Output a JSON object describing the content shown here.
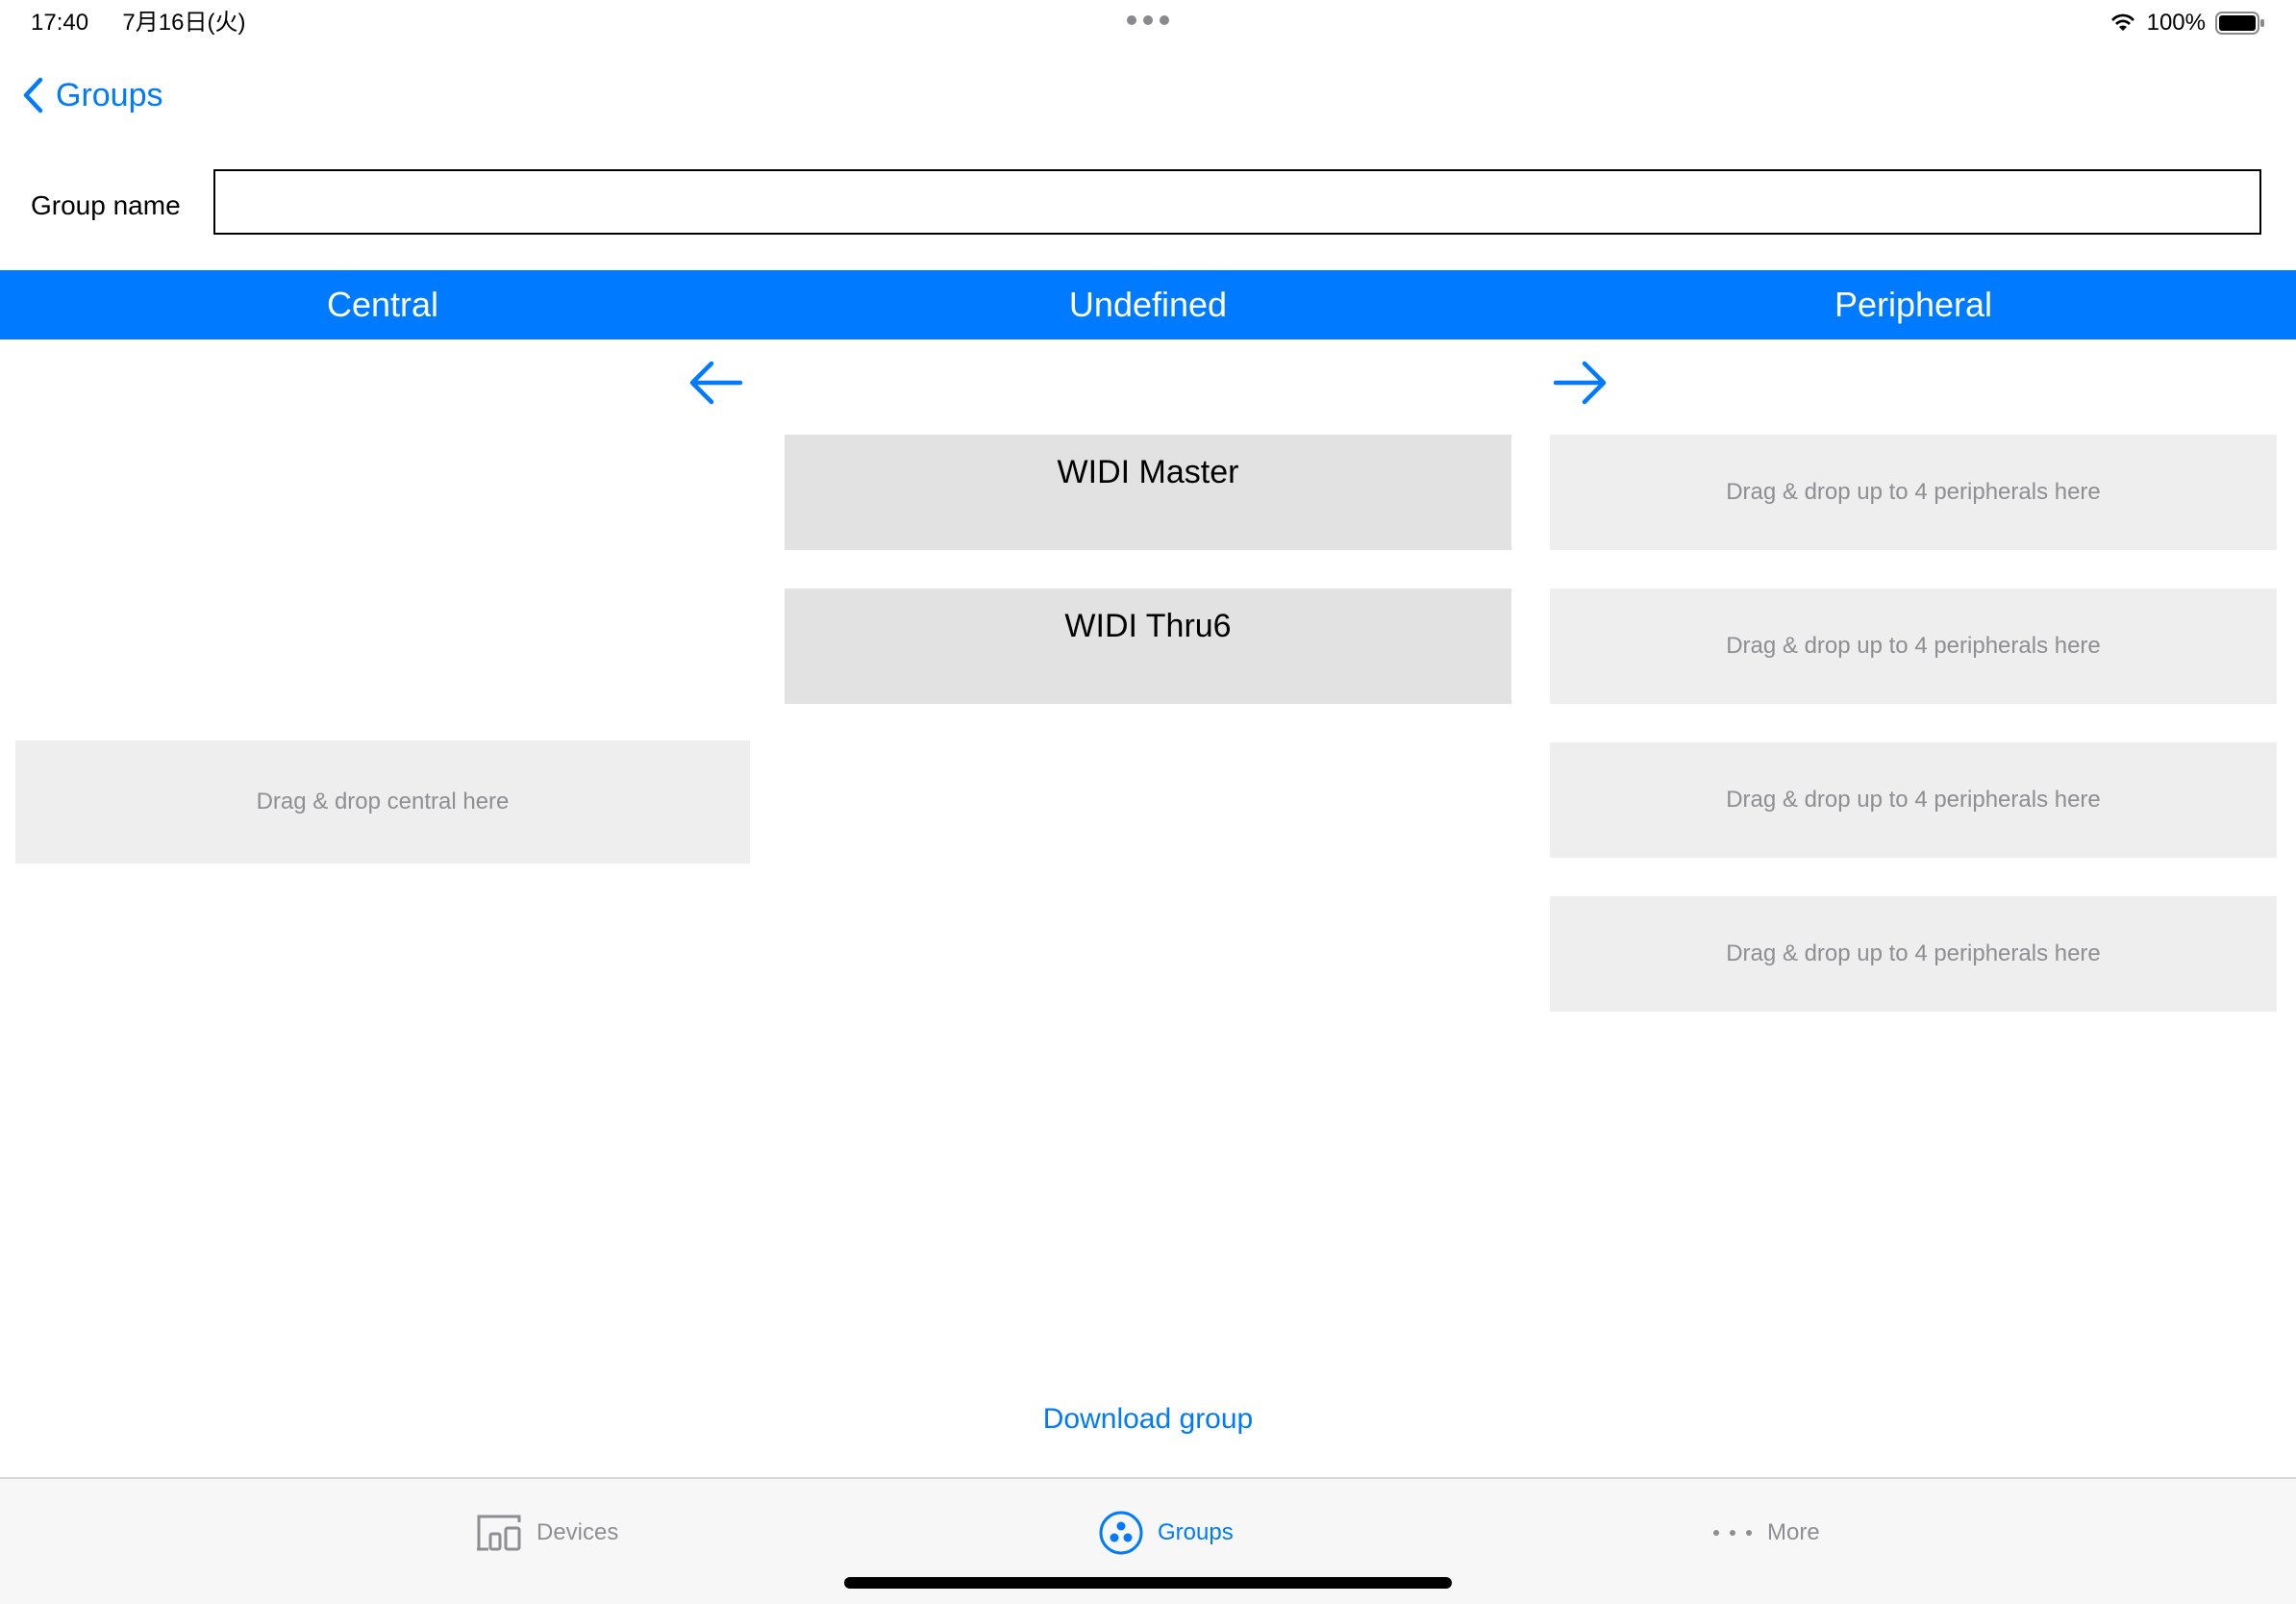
{
  "status_bar": {
    "time": "17:40",
    "date": "7月16日(火)",
    "battery_percent": "100%",
    "battery_level": 1.0
  },
  "nav": {
    "back_label": "Groups"
  },
  "group_name": {
    "label": "Group name",
    "value": "",
    "placeholder": ""
  },
  "columns": {
    "central": "Central",
    "undefined": "Undefined",
    "peripheral": "Peripheral"
  },
  "undefined_devices": [
    "WIDI Master",
    "WIDI Thru6"
  ],
  "central_slot": "Drag & drop central here",
  "peripheral_slots": [
    "Drag & drop up to 4 peripherals here",
    "Drag & drop up to 4 peripherals here",
    "Drag & drop up to 4 peripherals here",
    "Drag & drop up to 4 peripherals here"
  ],
  "download_button": "Download group",
  "tabs": [
    {
      "label": "Devices",
      "icon": "devices-icon",
      "active": false
    },
    {
      "label": "Groups",
      "icon": "groups-icon",
      "active": true
    },
    {
      "label": "More",
      "icon": "more-icon",
      "active": false
    }
  ],
  "colors": {
    "accent": "#007aff",
    "inactive": "#8e8e93",
    "slot_bg": "#eeeeee",
    "card_bg": "#e2e2e2"
  }
}
